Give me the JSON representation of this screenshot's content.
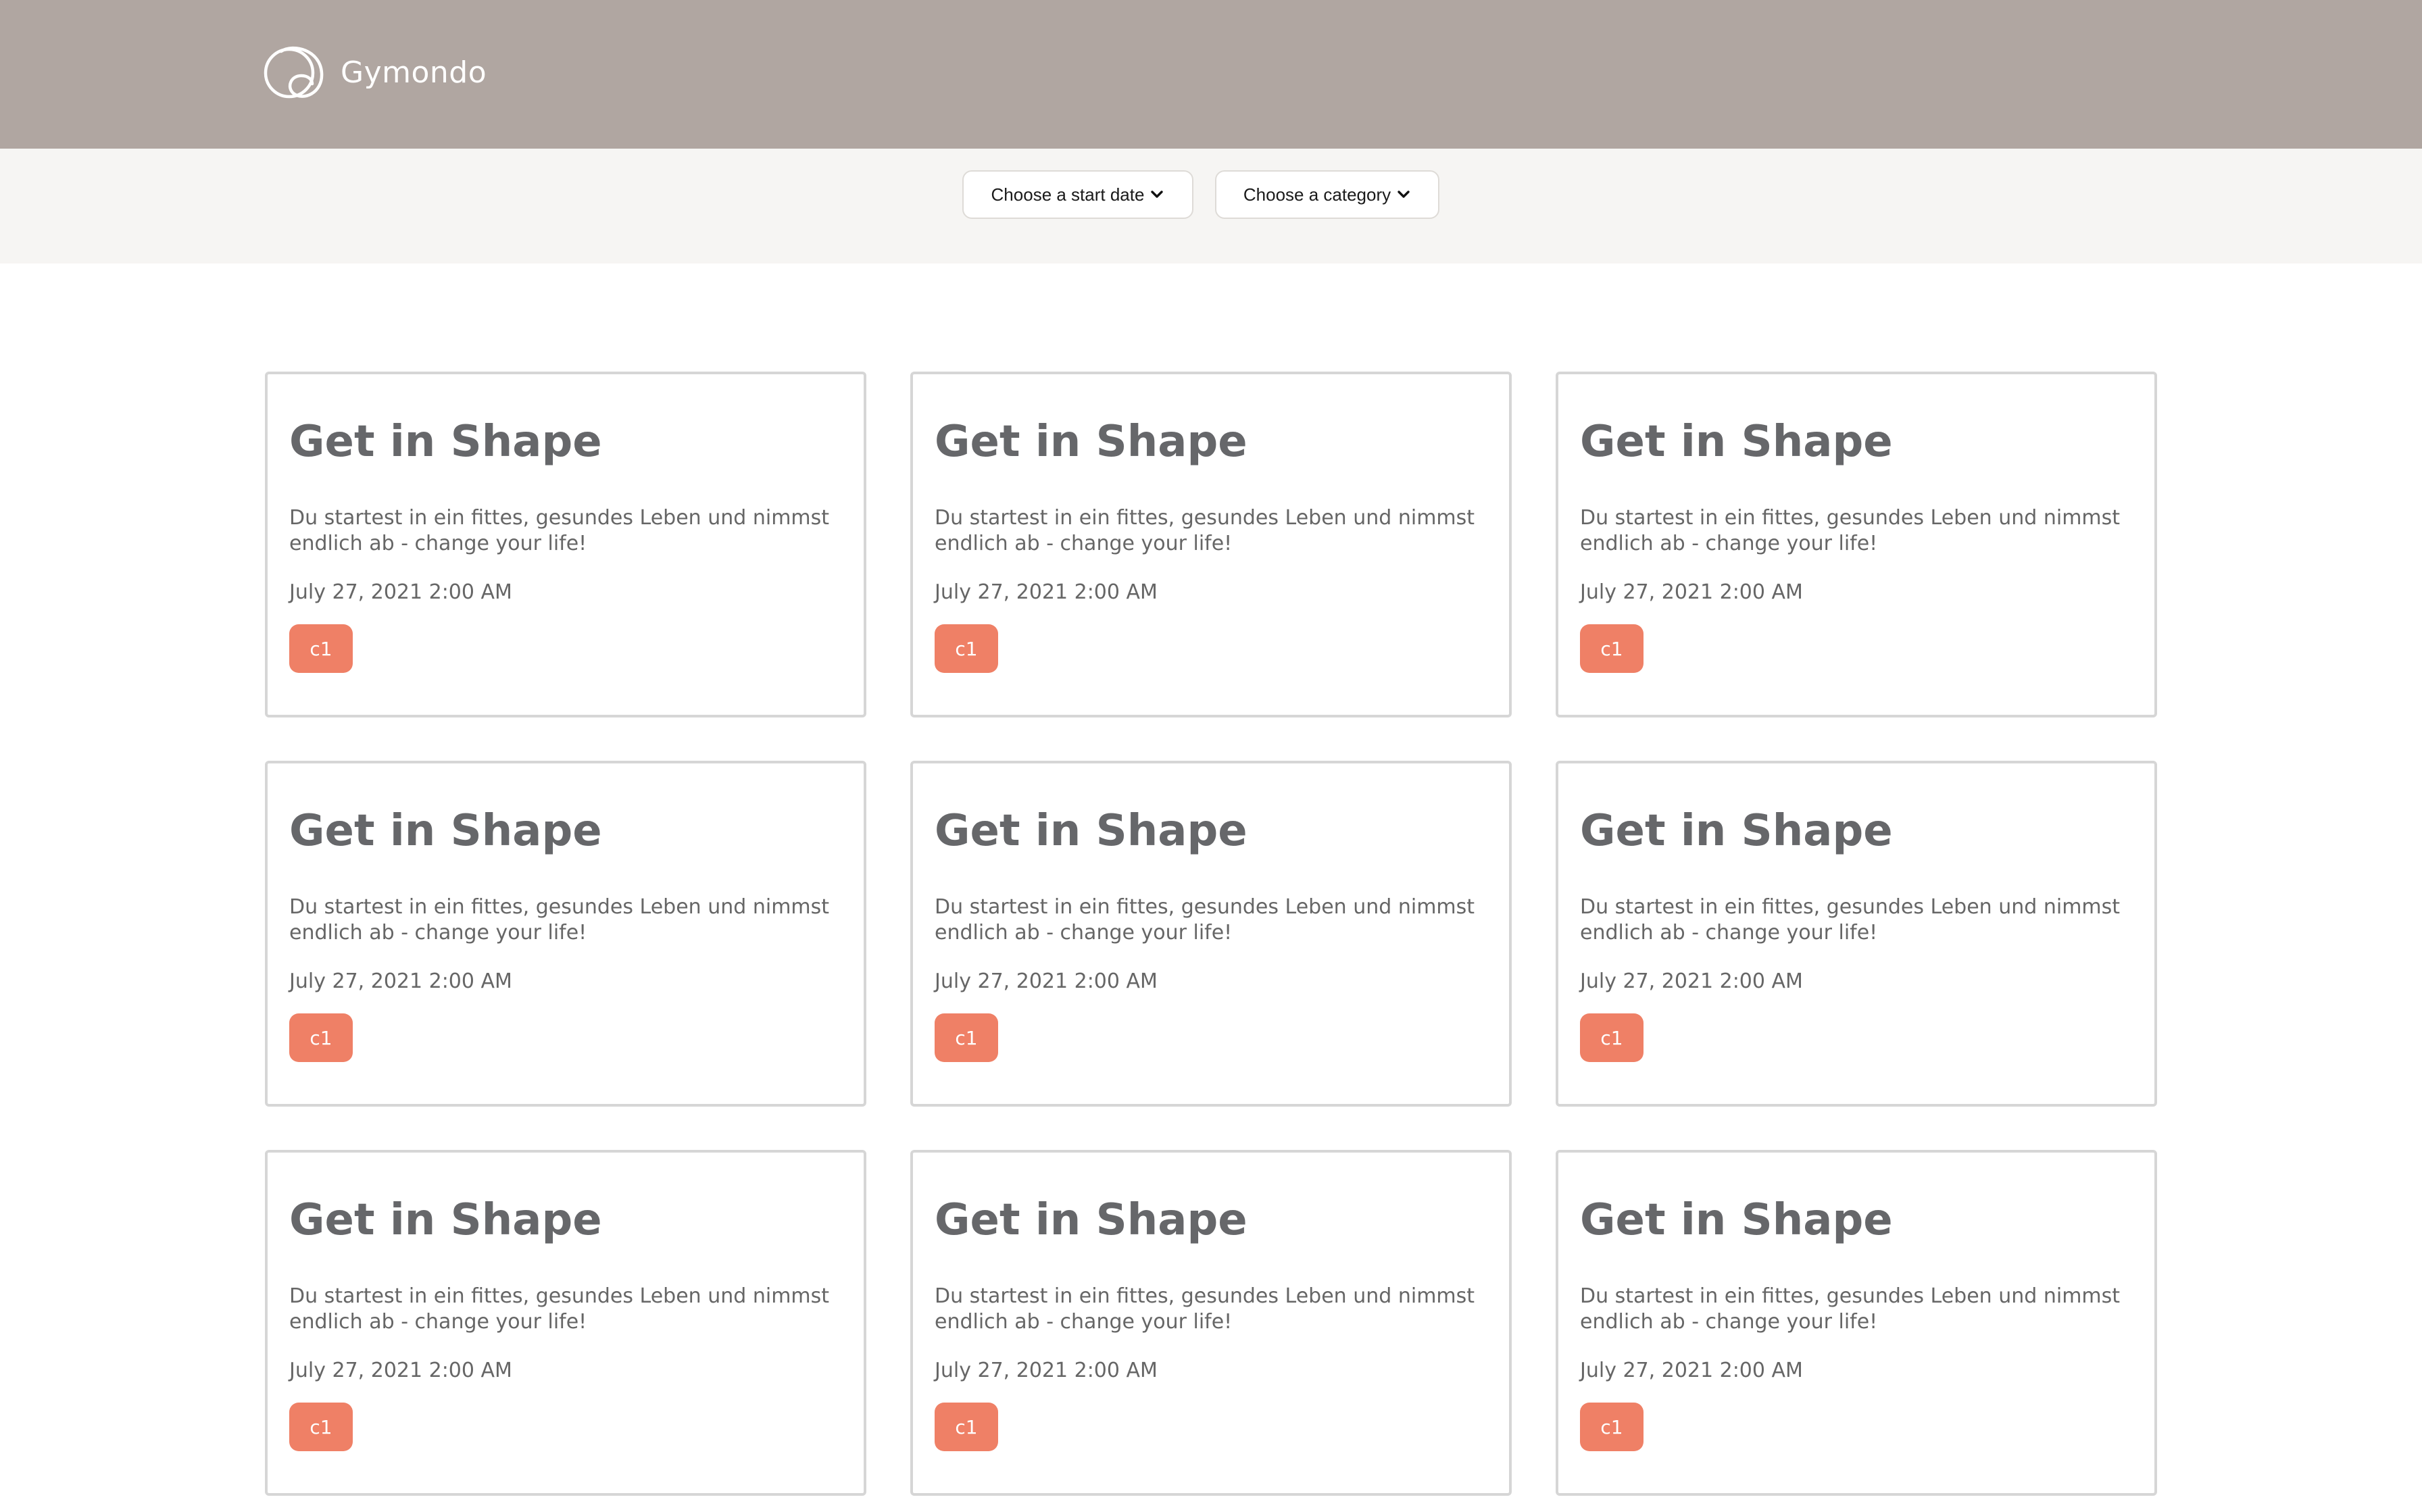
{
  "header": {
    "brand_name": "Gymondo"
  },
  "filters": {
    "start_date_label": "Choose a start date",
    "category_label": "Choose a category"
  },
  "colors": {
    "header_bg": "#b0a6a1",
    "filterbar_bg": "#f6f5f3",
    "badge": "#ef8066",
    "card_border": "#d6d6d6",
    "text": "#666666"
  },
  "programs": [
    {
      "title": "Get in Shape",
      "description": "Du startest in ein fittes, gesundes Leben und nimmst endlich ab - change your life!",
      "date": "July 27, 2021 2:00 AM",
      "category": "c1"
    },
    {
      "title": "Get in Shape",
      "description": "Du startest in ein fittes, gesundes Leben und nimmst endlich ab - change your life!",
      "date": "July 27, 2021 2:00 AM",
      "category": "c1"
    },
    {
      "title": "Get in Shape",
      "description": "Du startest in ein fittes, gesundes Leben und nimmst endlich ab - change your life!",
      "date": "July 27, 2021 2:00 AM",
      "category": "c1"
    },
    {
      "title": "Get in Shape",
      "description": "Du startest in ein fittes, gesundes Leben und nimmst endlich ab - change your life!",
      "date": "July 27, 2021 2:00 AM",
      "category": "c1"
    },
    {
      "title": "Get in Shape",
      "description": "Du startest in ein fittes, gesundes Leben und nimmst endlich ab - change your life!",
      "date": "July 27, 2021 2:00 AM",
      "category": "c1"
    },
    {
      "title": "Get in Shape",
      "description": "Du startest in ein fittes, gesundes Leben und nimmst endlich ab - change your life!",
      "date": "July 27, 2021 2:00 AM",
      "category": "c1"
    },
    {
      "title": "Get in Shape",
      "description": "Du startest in ein fittes, gesundes Leben und nimmst endlich ab - change your life!",
      "date": "July 27, 2021 2:00 AM",
      "category": "c1"
    },
    {
      "title": "Get in Shape",
      "description": "Du startest in ein fittes, gesundes Leben und nimmst endlich ab - change your life!",
      "date": "July 27, 2021 2:00 AM",
      "category": "c1"
    },
    {
      "title": "Get in Shape",
      "description": "Du startest in ein fittes, gesundes Leben und nimmst endlich ab - change your life!",
      "date": "July 27, 2021 2:00 AM",
      "category": "c1"
    }
  ]
}
